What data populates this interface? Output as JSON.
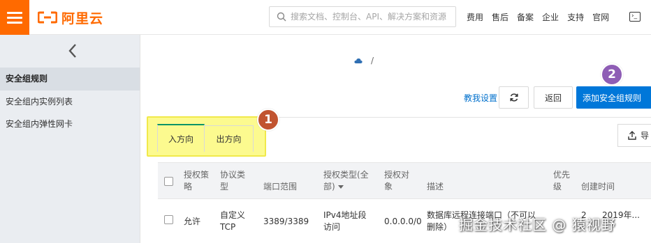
{
  "header": {
    "brand": "阿里云",
    "search_placeholder": "搜索文档、控制台、API、解决方案和资源",
    "nav": [
      "费用",
      "售后",
      "备案",
      "企业",
      "支持",
      "官网"
    ],
    "terminal_glyph": "›_"
  },
  "sidebar": {
    "items": [
      {
        "label": "安全组规则",
        "active": true
      },
      {
        "label": "安全组内实例列表",
        "active": false
      },
      {
        "label": "安全组内弹性网卡",
        "active": false
      }
    ]
  },
  "breadcrumb": {
    "separator": "/"
  },
  "toolbar": {
    "teach_label": "教我设置",
    "back_label": "返回",
    "add_rule_label": "添加安全组规则",
    "export_label": "导"
  },
  "tabs": [
    {
      "label": "入方向",
      "active": true
    },
    {
      "label": "出方向",
      "active": false
    }
  ],
  "badges": [
    {
      "label": "1",
      "color": "#c1532f"
    },
    {
      "label": "2",
      "color": "#8e5db5"
    }
  ],
  "table": {
    "headers": {
      "policy": "授权策略",
      "protocol": "协议类型",
      "port": "端口范围",
      "auth_type": "授权类型(全部)",
      "auth_object": "授权对象",
      "description": "描述",
      "priority": "优先级",
      "created": "创建时间"
    },
    "rows": [
      {
        "policy": "允许",
        "protocol": "自定义 TCP",
        "port": "3389/3389",
        "auth_type": "IPv4地址段访问",
        "auth_object": "0.0.0.0/0",
        "description": "数据库远程连接端口（不可以删除）",
        "priority": "2",
        "created": "2019年..."
      }
    ]
  },
  "watermark": "掘金技术社区 @ 猿视野",
  "colors": {
    "accent": "#ff6a00",
    "primary": "#0077d9",
    "link": "#0070cc",
    "highlight": "#fcfa8f",
    "active_tab": "#0b9466"
  }
}
